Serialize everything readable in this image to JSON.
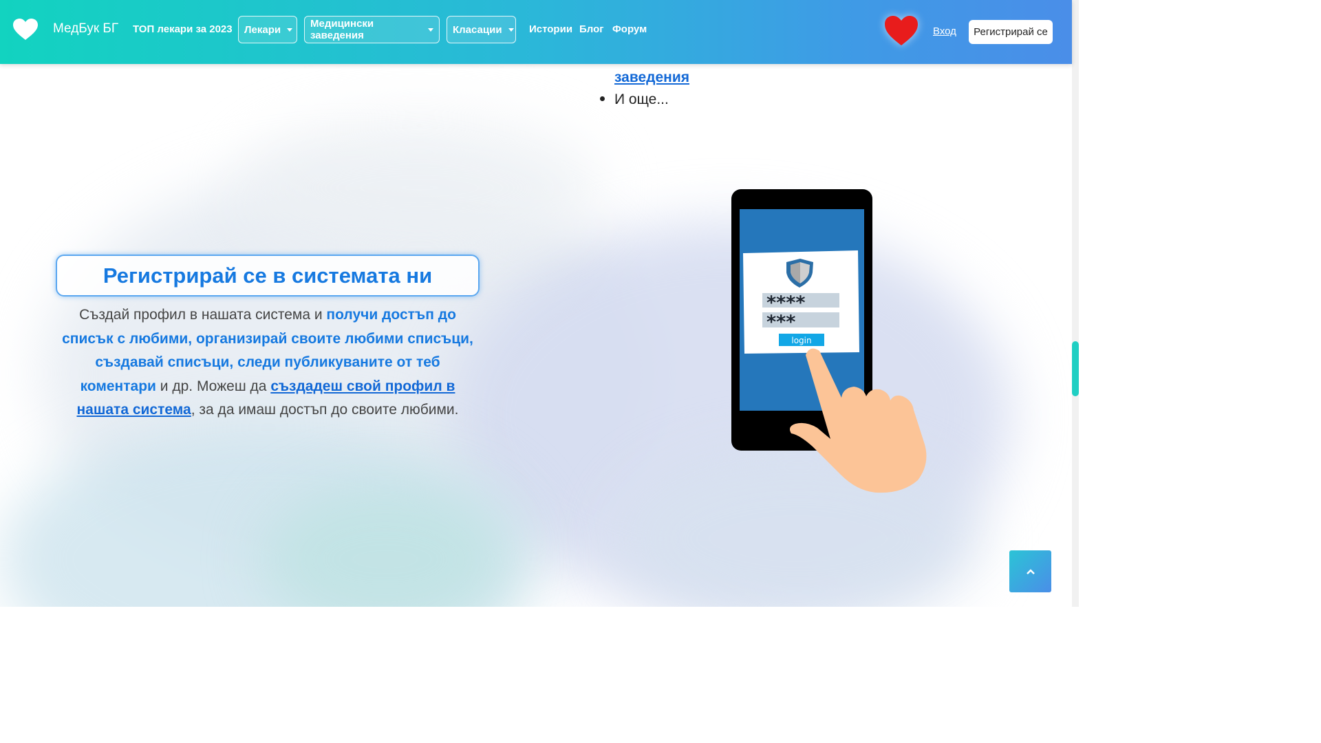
{
  "navbar": {
    "brand": "МедБук БГ",
    "top_doctors": "ТОП лекари за 2023",
    "dropdowns": [
      {
        "label": "Лекари"
      },
      {
        "label": "Медицински заведения"
      },
      {
        "label": "Класации"
      }
    ],
    "links": {
      "stories": "Истории",
      "blog": "Блог",
      "forum": "Форум"
    },
    "login": "Вход",
    "register": "Регистрирай се",
    "icons": {
      "logo": "heart-icon",
      "favorites": "heart-icon"
    },
    "colors": {
      "gradient_start": "#12d3c0",
      "gradient_end": "#4a8ee8",
      "heart": "#e81c1c"
    }
  },
  "list_fragment": {
    "link_text": "заведения",
    "more_item": "И още..."
  },
  "register_section": {
    "heading": "Регистрирай се в системата ни",
    "desc_part1": "Създай профил в нашата система и ",
    "desc_highlight": "получи достъп до списък с любими, организирай своите любими списъци, създавай списъци, следи публикуваните от теб коментари",
    "desc_part2": " и др. Можеш да ",
    "desc_link": "създадеш свой профил в нашата система",
    "desc_part3": ", за да имаш достъп до своите любими.",
    "illustration": {
      "password1": "****",
      "password2": "***",
      "button": "login"
    }
  },
  "back_to_top": {
    "icon": "chevron-up-icon"
  },
  "colors": {
    "accent": "#1679e0",
    "link": "#1268d6"
  }
}
